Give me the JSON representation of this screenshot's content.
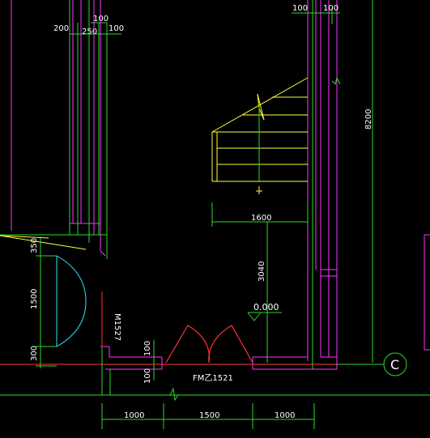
{
  "colors": {
    "background": "#000000",
    "dimension": "#2bd82b",
    "wall": "#ff33ff",
    "stair": "#ffff33",
    "door_double": "#ff3333",
    "door_single": "#33e6ff",
    "axis": "#ff3333",
    "text": "#ffffff"
  },
  "dimensions": {
    "top_left_a": "200",
    "top_left_b": "250",
    "top_left_c": "100",
    "top_left_d": "100",
    "top_right_a": "100",
    "top_right_b": "100",
    "right_height": "8200",
    "stair_width": "1600",
    "stair_length": "3040",
    "left_a": "350",
    "left_b": "1500",
    "left_c": "300",
    "bottom_a": "1000",
    "bottom_b": "1500",
    "bottom_c": "1000",
    "wall_100_a": "100",
    "wall_100_b": "100"
  },
  "labels": {
    "door_left": "M1527",
    "door_bottom": "FM乙1521",
    "elevation": "0.000",
    "axis": "C"
  }
}
